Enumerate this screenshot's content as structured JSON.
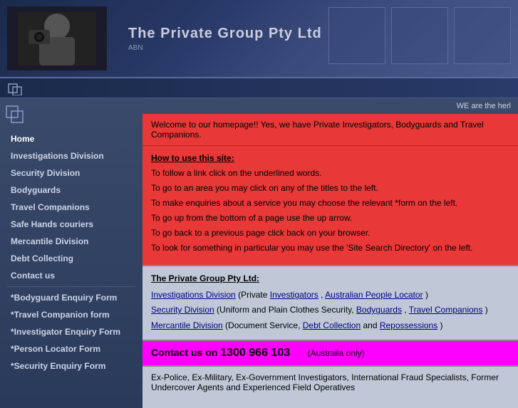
{
  "header": {
    "title": "The Private Group Pty Ltd",
    "subtitle": "ABN"
  },
  "marquee": {
    "text": "WE are the herl"
  },
  "sidebar": {
    "items": [
      {
        "label": "Home",
        "id": "home"
      },
      {
        "label": "Investigations Division",
        "id": "investigations"
      },
      {
        "label": "Security Division",
        "id": "security"
      },
      {
        "label": "Bodyguards",
        "id": "bodyguards"
      },
      {
        "label": "Travel Companions",
        "id": "travel-companions"
      },
      {
        "label": "Safe Hands couriers",
        "id": "safe-hands"
      },
      {
        "label": "Mercantile Division",
        "id": "mercantile"
      },
      {
        "label": "Debt Collecting",
        "id": "debt-collecting"
      },
      {
        "label": "Contact us",
        "id": "contact"
      },
      {
        "label": "*Bodyguard Enquiry Form",
        "id": "bodyguard-form"
      },
      {
        "label": "*Travel Companion form",
        "id": "travel-form"
      },
      {
        "label": "*Investigator Enquiry Form",
        "id": "investigator-form"
      },
      {
        "label": "*Person Locator Form",
        "id": "person-locator"
      },
      {
        "label": "*Security Enquiry Form",
        "id": "security-form"
      }
    ]
  },
  "welcome": {
    "text": "Welcome to our homepage!! Yes, we have Private Investigators, Bodyguards and Travel Companions."
  },
  "howto": {
    "title": "How to use this site",
    "instructions": [
      "To follow a link click on the underlined words.",
      "To go to an area you may click on any of the titles to the left.",
      "To make enquiries about a service you may choose the relevant *form on the left.",
      "To go up from the bottom of a page use the up arrow.",
      "To go back to a previous page click back on your browser.",
      "To look for something in particular you may use the 'Site Search Directory' on the left."
    ]
  },
  "links": {
    "title": "The Private Group Pty Ltd",
    "entries": [
      {
        "label": "Investigations Division",
        "description": " (Private ",
        "links": [
          "Investigators",
          "Australian People Locator"
        ],
        "suffix": ")"
      },
      {
        "label": "Security Division",
        "description": " (Uniform and Plain Clothes Security, ",
        "links": [
          "Bodyguards",
          "Travel Companions"
        ],
        "suffix": ")"
      },
      {
        "label": "Mercantile Division",
        "description": " (Document Service, ",
        "links": [
          "Debt Collection",
          "Repossessions"
        ],
        "suffix": ")"
      }
    ]
  },
  "contact": {
    "label": "Contact us on",
    "phone": "1300 966 103",
    "note": "(Australia only)"
  },
  "footer": {
    "text": "Ex-Police, Ex-Military, Ex-Government Investigators, International Fraud Specialists, Former Undercover Agents and Experienced Field Operatives"
  }
}
